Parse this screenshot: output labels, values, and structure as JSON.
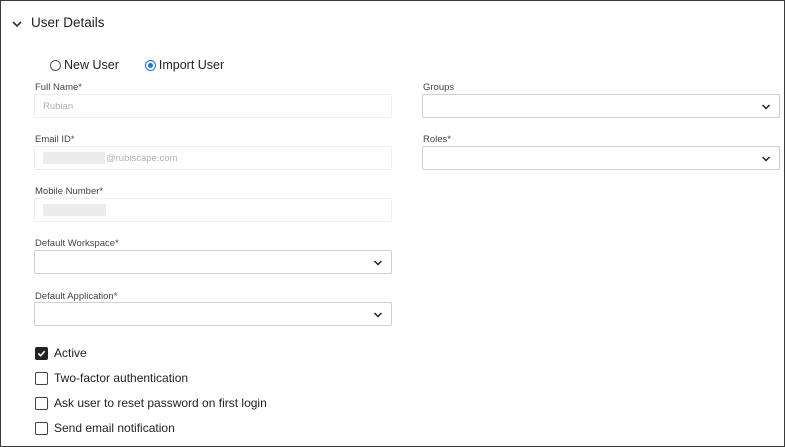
{
  "section": {
    "title": "User Details",
    "icon": "chevron-down-icon"
  },
  "user_type": {
    "options": [
      {
        "label": "New User",
        "selected": false
      },
      {
        "label": "Import User",
        "selected": true
      }
    ]
  },
  "form": {
    "full_name": {
      "label": "Full Name*",
      "value": "Rubian"
    },
    "email": {
      "label": "Email ID*",
      "value_suffix": "@rubiscape.com"
    },
    "mobile": {
      "label": "Mobile Number*"
    },
    "default_workspace": {
      "label": "Default Workspace*",
      "selected": ""
    },
    "default_application": {
      "label": "Default Application*",
      "selected": ""
    },
    "groups": {
      "label": "Groups",
      "selected": ""
    },
    "roles": {
      "label": "Roles*",
      "selected": ""
    }
  },
  "options": [
    {
      "label": "Active",
      "checked": true
    },
    {
      "label": "Two-factor authentication",
      "checked": false
    },
    {
      "label": "Ask user to reset password on first login",
      "checked": false
    },
    {
      "label": "Send email notification",
      "checked": false
    }
  ],
  "colors": {
    "accent": "#1a73e8",
    "frame_border": "#3a3a3a"
  }
}
